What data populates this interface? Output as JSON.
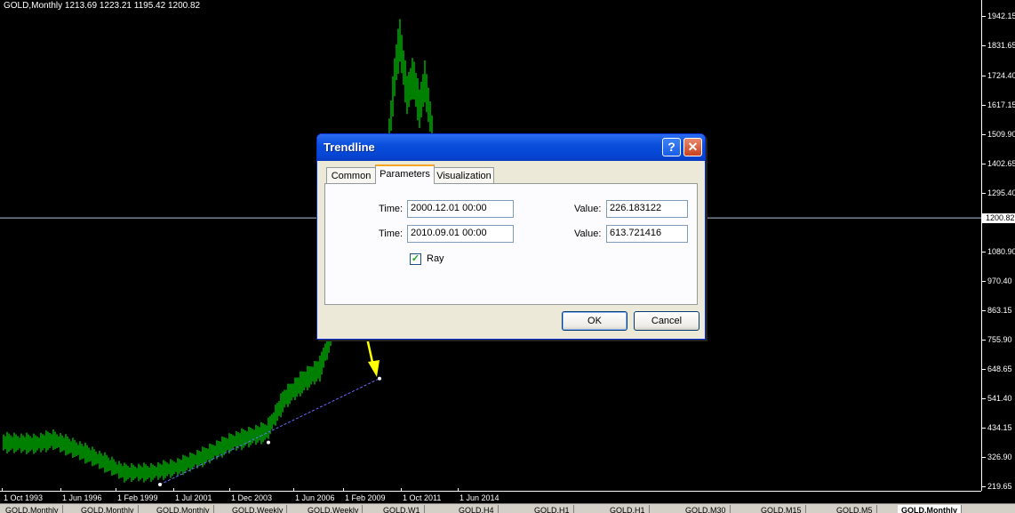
{
  "chart": {
    "title": "GOLD,Monthly  1213.69 1223.21 1195.42 1200.82",
    "colors": {
      "background": "#000000",
      "bars": "#00ff00",
      "axis_text": "#ffffff",
      "trendline": "#6a6aff",
      "arrow": "#ffff00"
    },
    "current_price": "1200.82",
    "y_ticks": [
      "1942.15",
      "1831.65",
      "1724.40",
      "1617.15",
      "1509.90",
      "1402.65",
      "1295.40",
      "1080.90",
      "970.40",
      "863.15",
      "755.90",
      "648.65",
      "541.40",
      "434.15",
      "326.90",
      "219.65"
    ],
    "x_ticks": [
      "1 Oct 1993",
      "1 Jun 1996",
      "1 Feb 1999",
      "1 Jul 2001",
      "1 Dec 2003",
      "1 Jun 2006",
      "1 Feb 2009",
      "1 Oct 2011",
      "1 Jun 2014"
    ],
    "bottom_tabs": [
      "GOLD,Monthly",
      "GOLD,Monthly",
      "GOLD,Monthly",
      "GOLD,Weekly",
      "GOLD,Weekly",
      "GOLD,W1",
      "GOLD,H4",
      "GOLD,H1",
      "GOLD,H1",
      "GOLD,M30",
      "GOLD,M15",
      "GOLD,M5",
      "GOLD,Monthly"
    ]
  },
  "dialog": {
    "title": "Trendline",
    "help_label": "?",
    "close_label": "✕",
    "tabs": [
      "Common",
      "Parameters",
      "Visualization"
    ],
    "active_tab": "Parameters",
    "time_label": "Time:",
    "value_label": "Value:",
    "time1": "2000.12.01 00:00",
    "time2": "2010.09.01 00:00",
    "value1": "226.183122",
    "value2": "613.721416",
    "ray_label": "Ray",
    "ray_checked": true,
    "ok_label": "OK",
    "cancel_label": "Cancel"
  }
}
